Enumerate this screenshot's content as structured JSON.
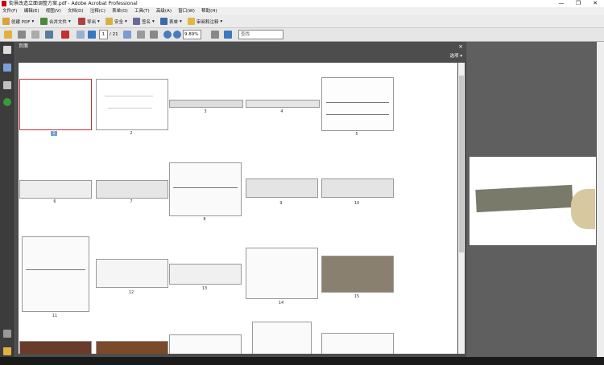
{
  "window": {
    "title": "街景改造立面调整方案.pdf - Adobe Acrobat Professional",
    "controls": [
      "—",
      "❐",
      "✕"
    ]
  },
  "menu": [
    "文件(F)",
    "编辑(E)",
    "视图(V)",
    "文档(D)",
    "注释(C)",
    "表单(O)",
    "工具(T)",
    "高级(A)",
    "窗口(W)",
    "帮助(H)"
  ],
  "toolbar1": {
    "create_pdf": "创建 PDF",
    "combine": "合并文件",
    "export": "导出",
    "secure": "安全",
    "sign": "签名",
    "forms": "表单",
    "review": "审阅和注释"
  },
  "toolbar2": {
    "page_current": "1",
    "page_total": "/ 21",
    "zoom": "9.89%",
    "find_placeholder": "查找"
  },
  "panel": {
    "title": "页面",
    "close": "×",
    "options": "选项 ▾"
  },
  "thumbnails": [
    {
      "label": "1"
    },
    {
      "label": "2"
    },
    {
      "label": "3"
    },
    {
      "label": "4"
    },
    {
      "label": "5"
    },
    {
      "label": "6"
    },
    {
      "label": "7"
    },
    {
      "label": "8"
    },
    {
      "label": "9"
    },
    {
      "label": "10"
    },
    {
      "label": "11"
    },
    {
      "label": "12"
    },
    {
      "label": "13"
    },
    {
      "label": "14"
    },
    {
      "label": "15"
    }
  ],
  "colors": {
    "accent": "#6fa0d8",
    "selected_border": "#c03030",
    "panel_bg": "#4d4d4d"
  }
}
